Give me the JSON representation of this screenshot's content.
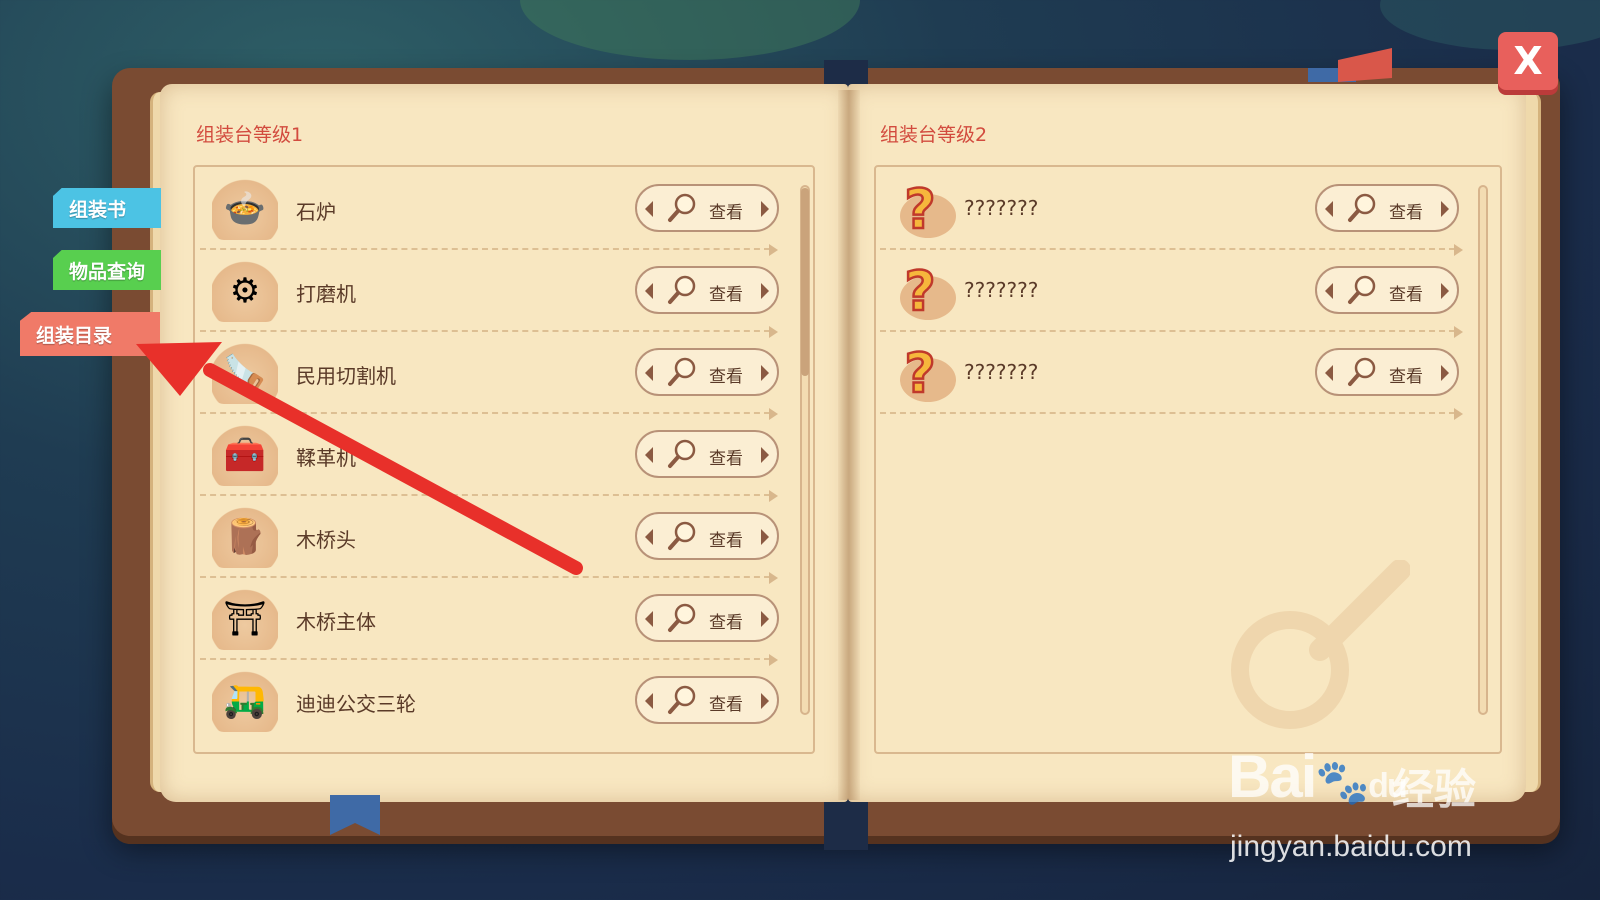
{
  "tabs": [
    {
      "label": "组装书"
    },
    {
      "label": "物品查询"
    },
    {
      "label": "组装目录"
    }
  ],
  "close_label": "X",
  "left_page": {
    "title": "组装台等级1",
    "items": [
      {
        "name": "石炉",
        "icon": "stone-furnace-icon",
        "button": "查看"
      },
      {
        "name": "打磨机",
        "icon": "grinder-icon",
        "button": "查看"
      },
      {
        "name": "民用切割机",
        "icon": "cutter-icon",
        "button": "查看"
      },
      {
        "name": "鞣革机",
        "icon": "tanning-machine-icon",
        "button": "查看"
      },
      {
        "name": "木桥头",
        "icon": "bridge-head-icon",
        "button": "查看"
      },
      {
        "name": "木桥主体",
        "icon": "bridge-body-icon",
        "button": "查看"
      },
      {
        "name": "迪迪公交三轮",
        "icon": "tricycle-icon",
        "button": "查看"
      }
    ]
  },
  "right_page": {
    "title": "组装台等级2",
    "items": [
      {
        "name": "???????",
        "icon": "question-mark-icon",
        "button": "查看"
      },
      {
        "name": "???????",
        "icon": "question-mark-icon",
        "button": "查看"
      },
      {
        "name": "???????",
        "icon": "question-mark-icon",
        "button": "查看"
      }
    ]
  },
  "watermark": {
    "logo": "Bai",
    "logo_paw": "du",
    "text": "经验",
    "url": "jingyan.baidu.com"
  },
  "colors": {
    "title_red": "#d24b3e",
    "tab_blue": "#4cc3e4",
    "tab_green": "#58cf4f",
    "tab_red": "#f07a68",
    "close_red": "#e8605c",
    "annotation_arrow": "#e8302a"
  }
}
